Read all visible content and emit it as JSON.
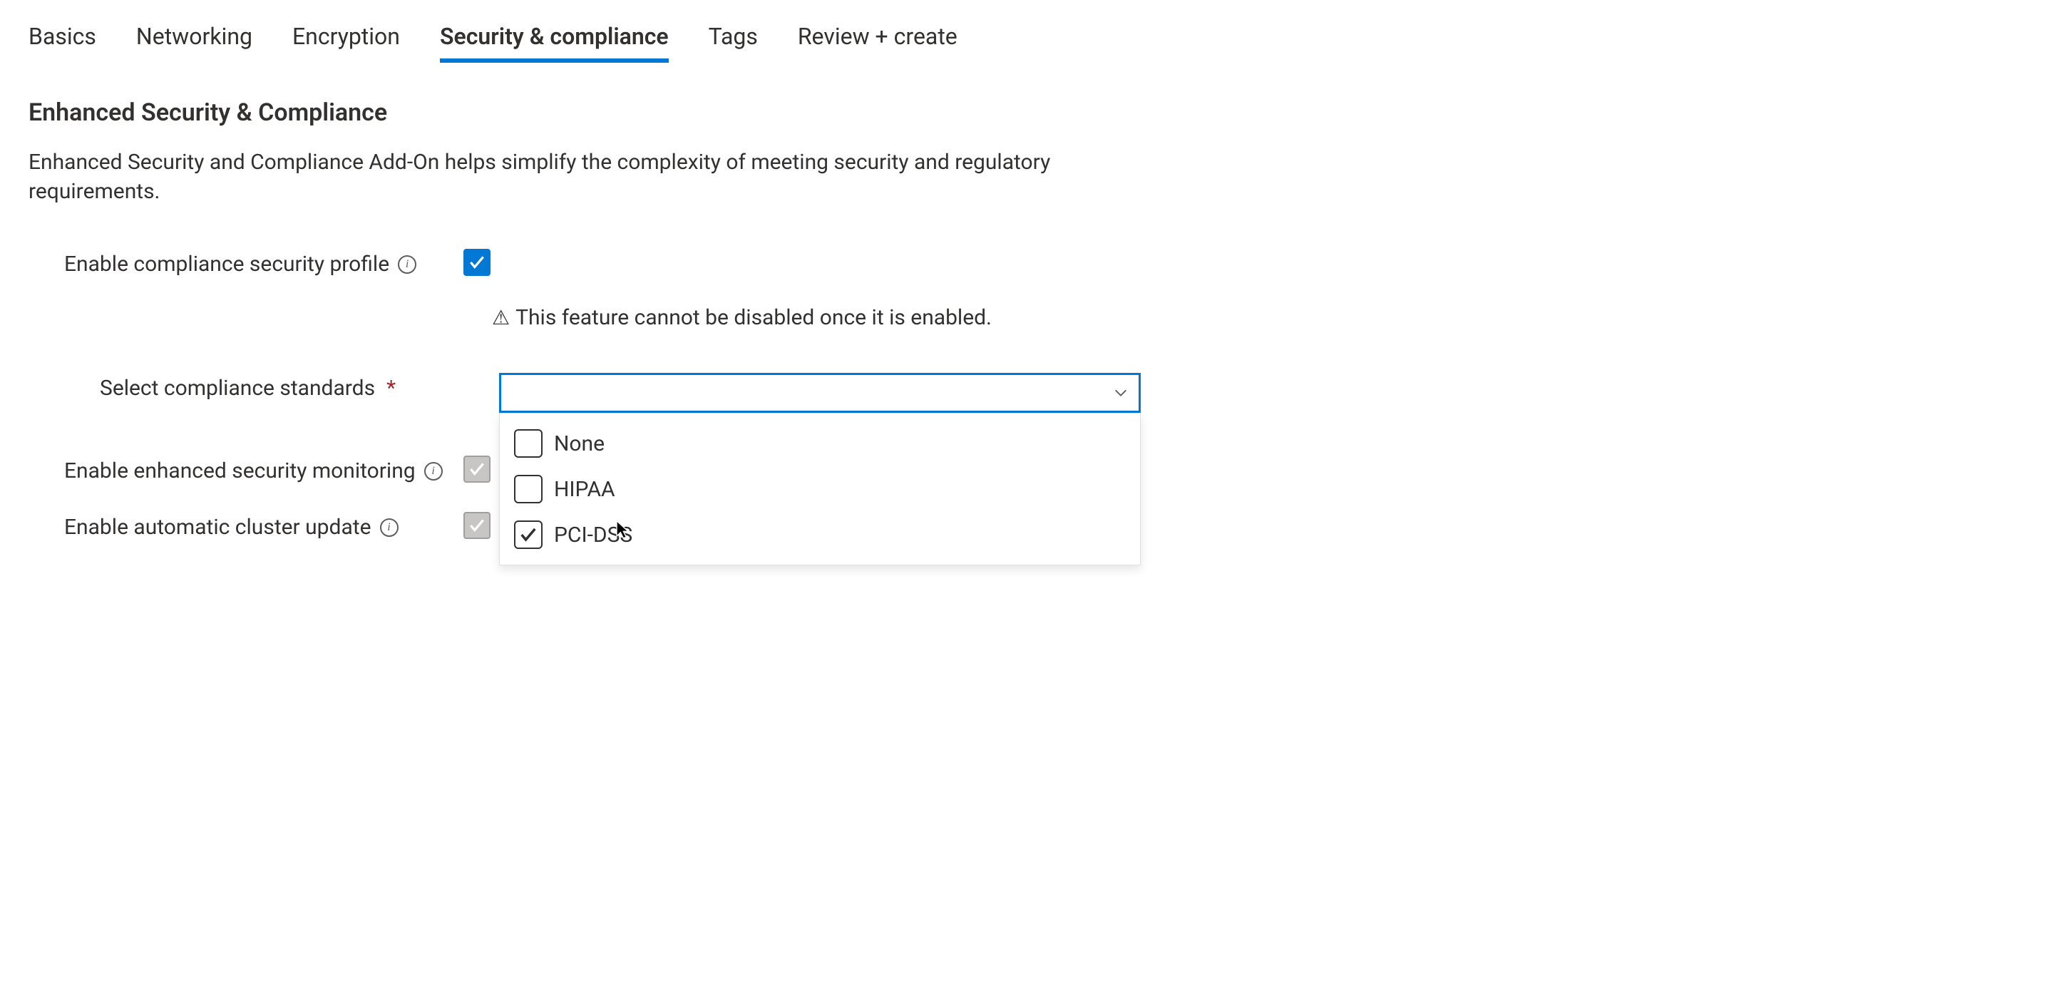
{
  "tabs": {
    "items": [
      {
        "label": "Basics",
        "active": false
      },
      {
        "label": "Networking",
        "active": false
      },
      {
        "label": "Encryption",
        "active": false
      },
      {
        "label": "Security & compliance",
        "active": true
      },
      {
        "label": "Tags",
        "active": false
      },
      {
        "label": "Review + create",
        "active": false
      }
    ]
  },
  "section": {
    "title": "Enhanced Security & Compliance",
    "description": "Enhanced Security and Compliance Add-On helps simplify the complexity of meeting security and regulatory requirements."
  },
  "fields": {
    "enable_profile": {
      "label": "Enable compliance security profile",
      "checked": true,
      "warning": "This feature cannot be disabled once it is enabled."
    },
    "select_standards": {
      "label": "Select compliance standards",
      "required": true,
      "selected_value": "",
      "options": [
        {
          "label": "None",
          "checked": false
        },
        {
          "label": "HIPAA",
          "checked": false
        },
        {
          "label": "PCI-DSS",
          "checked": true
        }
      ]
    },
    "enable_monitoring": {
      "label": "Enable enhanced security monitoring",
      "checked": true,
      "disabled": true
    },
    "enable_auto_update": {
      "label": "Enable automatic cluster update",
      "checked": true,
      "disabled": true
    }
  },
  "colors": {
    "accent": "#0078d4",
    "text": "#323130"
  }
}
